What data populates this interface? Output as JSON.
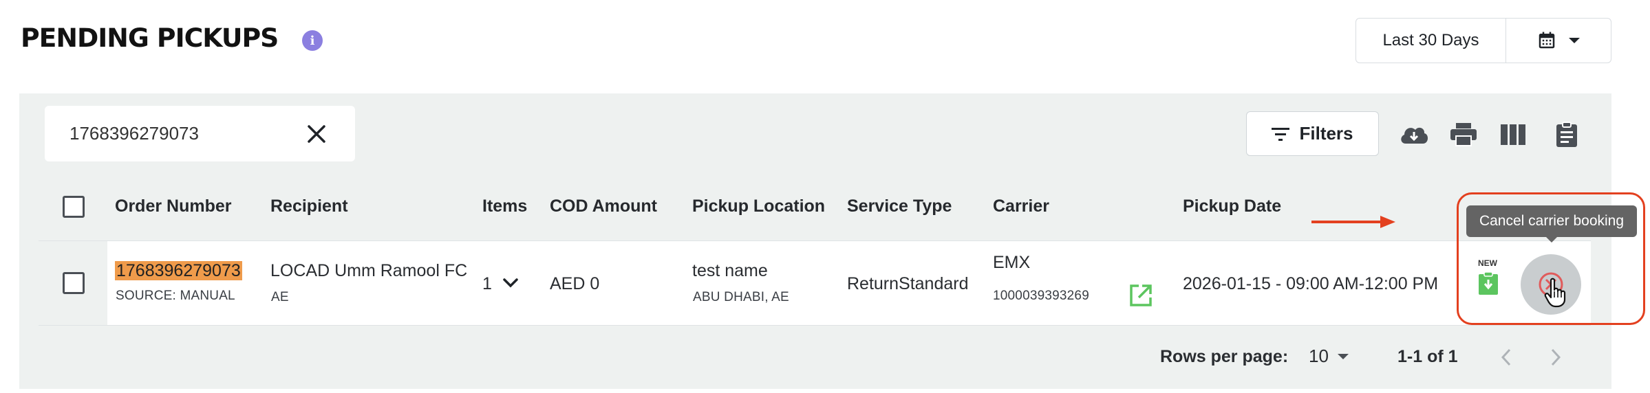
{
  "header": {
    "title": "PENDING PICKUPS",
    "info_icon": "info-icon",
    "date_range": "Last 30 Days"
  },
  "search": {
    "value": "1768396279073"
  },
  "toolbar": {
    "filters_label": "Filters",
    "icons": [
      "download-icon",
      "print-icon",
      "columns-icon",
      "clipboard-icon"
    ]
  },
  "table": {
    "columns": [
      "Order Number",
      "Recipient",
      "Items",
      "COD Amount",
      "Pickup Location",
      "Service Type",
      "Carrier",
      "Pickup Date"
    ],
    "rows": [
      {
        "order_number": "1768396279073",
        "source": "SOURCE: MANUAL",
        "recipient": "LOCAD Umm Ramool FC",
        "recipient_country": "AE",
        "items": "1",
        "cod_amount": "AED 0",
        "pickup_name": "test name",
        "pickup_city": "ABU DHABI, AE",
        "service_type": "ReturnStandard",
        "carrier": "EMX",
        "tracking": "1000039393269",
        "pickup_date": "2026-01-15 - 09:00 AM-12:00 PM",
        "new_badge": "NEW"
      }
    ]
  },
  "tooltip": {
    "text": "Cancel carrier booking"
  },
  "pagination": {
    "rows_per_page_label": "Rows per page:",
    "rows_per_page_value": "10",
    "range": "1-1 of 1"
  },
  "colors": {
    "accent_info": "#8b7fe0",
    "highlight": "#ef9b4b",
    "annotation": "#e3401f",
    "success_green": "#5cc55f",
    "cancel_red": "#e05b5b"
  }
}
